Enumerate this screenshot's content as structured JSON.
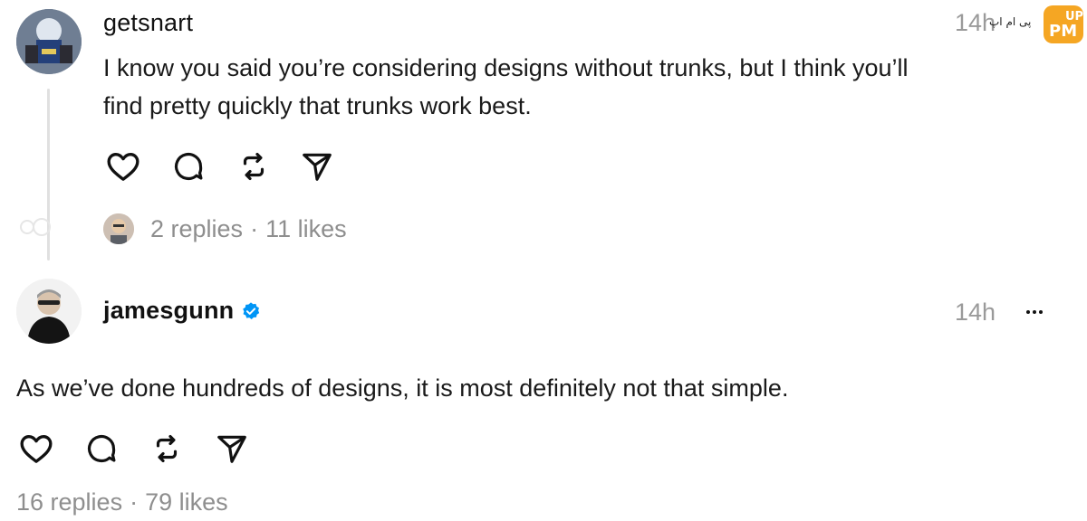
{
  "posts": [
    {
      "username": "getsnart",
      "time": "14h",
      "text_line1": "I know you said you’re considering designs without trunks, but I think you’ll",
      "text_line2": "find pretty quickly that trunks work best.",
      "replies": "2 replies",
      "separator": "·",
      "likes": "11 likes"
    },
    {
      "username": "jamesgunn",
      "verified": true,
      "time": "14h",
      "text": "As we’ve done hundreds of designs, it is most definitely not that simple.",
      "replies": "16 replies",
      "separator": "·",
      "likes": "79 likes"
    }
  ],
  "icons": [
    "heart-icon",
    "comment-icon",
    "repost-icon",
    "share-icon",
    "more-icon",
    "verified-badge-icon"
  ],
  "colors": {
    "text": "#111111",
    "muted": "#8e8e8e",
    "verified_blue": "#0095f6",
    "watermark_orange": "#f5a623"
  },
  "watermark": {
    "label": "پی ام اپ"
  }
}
